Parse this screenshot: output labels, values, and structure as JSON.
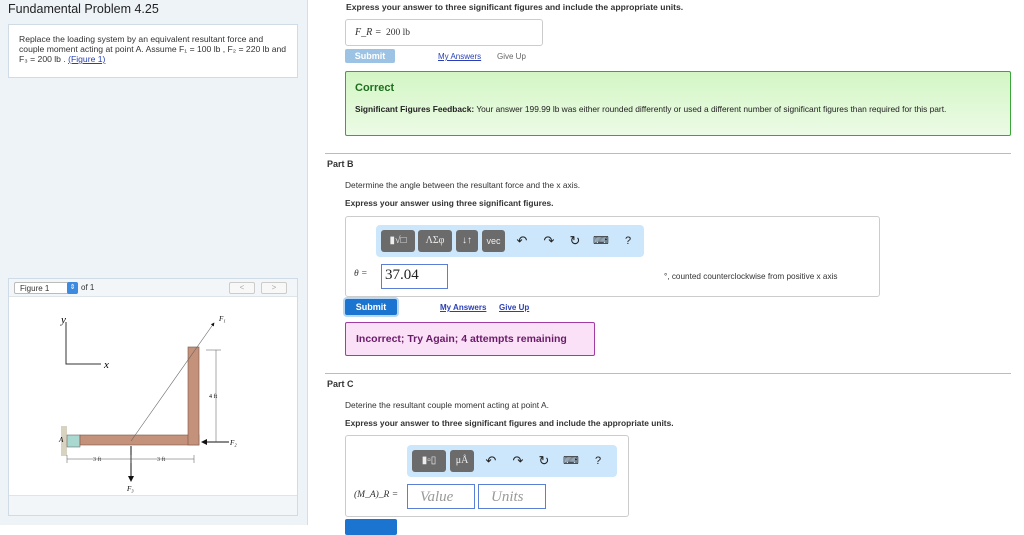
{
  "left": {
    "title": "Fundamental Problem 4.25",
    "problem_text": "Replace the loading system by an equivalent resultant force and couple moment acting at point A. Assume F₁ = 100 lb , F₂ = 220 lb and F₃ = 200 lb .",
    "figure_link": "(Figure 1)",
    "figure": {
      "selected": "Figure 1",
      "of": "of 1",
      "prev": "<",
      "next": ">",
      "labels": {
        "y": "y",
        "x": "x",
        "F1": "F₁",
        "F2": "F₂",
        "F3": "F₃",
        "A": "A",
        "dim_4ft": "4 ft",
        "dim_3ft_a": "3 ft",
        "dim_3ft_b": "3 ft"
      }
    }
  },
  "partA": {
    "instruction": "Express your answer to three significant figures and include the appropriate units.",
    "label": "F_R =",
    "answer": "200 lb",
    "submit": "Submit",
    "my_answers": "My Answers",
    "give_up": "Give Up",
    "feedback_title": "Correct",
    "feedback_label": "Significant Figures Feedback:",
    "feedback_text": " Your answer 199.99 lb was either rounded differently or used a different number of significant figures than required for this part."
  },
  "partB": {
    "title": "Part B",
    "question": "Determine the angle between the resultant force and the x axis.",
    "instruction": "Express your answer using three significant figures.",
    "toolbar": {
      "templates": "▮√□",
      "greek": "ΛΣφ",
      "arrows": "↓↑",
      "vec": "vec",
      "help": "?"
    },
    "label": "θ =",
    "answer": "37.04",
    "unit_text": "°, counted counterclockwise from positive x axis",
    "submit": "Submit",
    "my_answers": "My Answers",
    "give_up": "Give Up",
    "feedback": "Incorrect; Try Again; 4 attempts remaining"
  },
  "partC": {
    "title": "Part C",
    "question": "Deterine the resultant couple moment acting at point A.",
    "instruction": "Express your answer to three significant figures and include the appropriate units.",
    "toolbar": {
      "units": "μÅ",
      "help": "?"
    },
    "label": "(M_A)_R =",
    "value_placeholder": "Value",
    "units_placeholder": "Units"
  },
  "colors": {
    "correct_bg": "#dbf7cf",
    "correct_border": "#3aa63a",
    "incorrect_bg": "#fbe1f7",
    "incorrect_border": "#a23ba2",
    "submit": "#1b74d0"
  }
}
